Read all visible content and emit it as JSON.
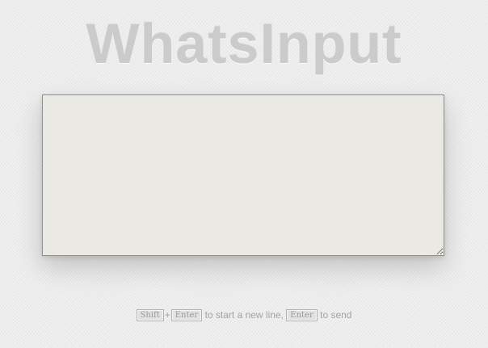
{
  "app": {
    "title": "WhatsInput"
  },
  "message_input": {
    "value": "",
    "placeholder": ""
  },
  "hint": {
    "key_shift": "Shift",
    "plus": "+",
    "key_enter_newline": "Enter",
    "newline_text": "to start a new line,",
    "key_enter_send": "Enter",
    "send_text": "to send"
  },
  "colors": {
    "background": "#ececec",
    "title": "#cbcbcb",
    "input_background": "#eae9e3",
    "hint_text": "#a3a3a3"
  }
}
